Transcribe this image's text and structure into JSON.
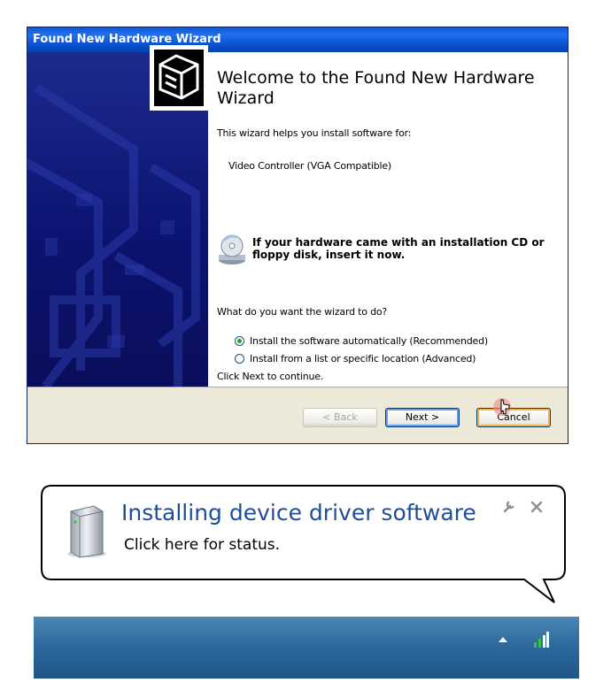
{
  "wizard": {
    "title": "Found New Hardware Wizard",
    "heading": "Welcome to the Found New Hardware Wizard",
    "intro": "This wizard helps you install software for:",
    "device": "Video Controller (VGA Compatible)",
    "cd_note": "If your hardware came with an installation CD or floppy disk, insert it now.",
    "question": "What do you want the wizard to do?",
    "options": [
      {
        "label": "Install the software automatically (Recommended)",
        "selected": true
      },
      {
        "label": "Install from a list or specific location (Advanced)",
        "selected": false
      }
    ],
    "continue_text": "Click Next to continue.",
    "buttons": {
      "back": "< Back",
      "next": "Next >",
      "cancel": "Cancel"
    },
    "icons": {
      "hardware": "hardware-box-icon",
      "cd": "cd-drive-icon",
      "cursor": "mouse-pointer-icon"
    },
    "colors": {
      "titlebar": "#0a5bd8",
      "sidebar": "#0c1370",
      "body": "#ece9d8"
    }
  },
  "notification": {
    "title": "Installing device driver software",
    "subtitle": "Click here for status.",
    "icons": {
      "device": "external-drive-icon",
      "settings": "wrench-icon",
      "close": "close-icon",
      "tray_expand": "show-hidden-icons-arrow",
      "network": "network-icon"
    },
    "colors": {
      "title": "#1f4e96",
      "taskbar": "#2f6a9f"
    }
  }
}
